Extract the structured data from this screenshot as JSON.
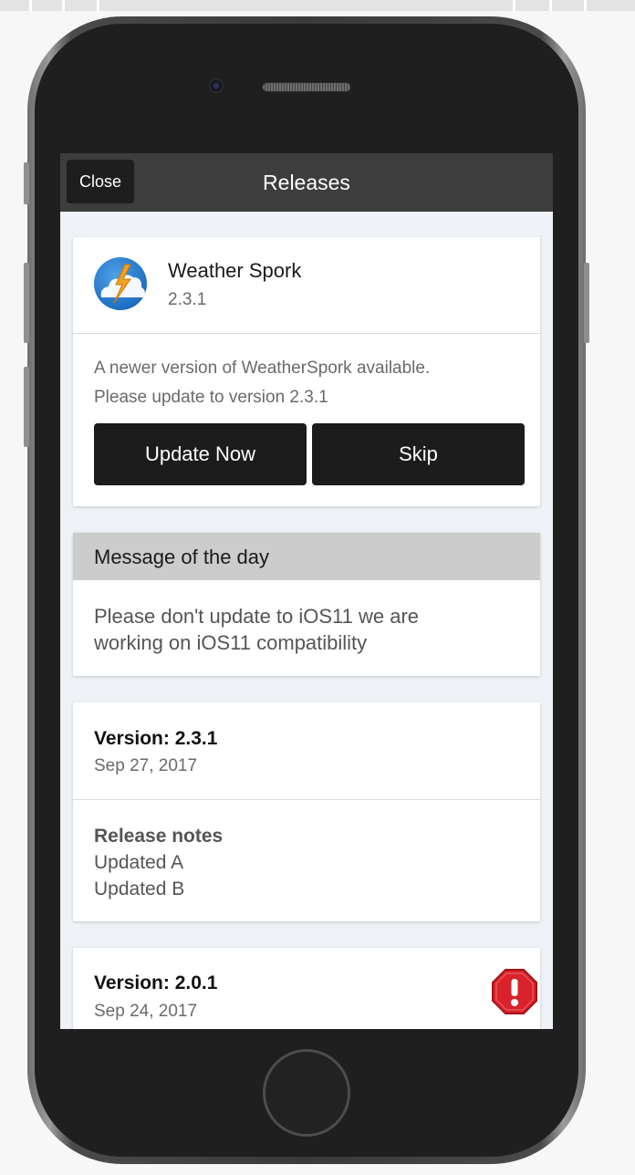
{
  "navbar": {
    "close_label": "Close",
    "title": "Releases"
  },
  "app": {
    "name": "Weather Spork",
    "version": "2.3.1",
    "update_line1": "A newer version of WeatherSpork available.",
    "update_line2": "Please update to version 2.3.1",
    "update_button": "Update Now",
    "skip_button": "Skip"
  },
  "motd": {
    "title": "Message of the day",
    "line1": "Please don't update to iOS11 we are",
    "line2": "working on iOS11 compatibility"
  },
  "releases": [
    {
      "version": "Version: 2.3.1",
      "date": "Sep 27, 2017",
      "notes_title": "Release notes",
      "notes": [
        "Updated A",
        "Updated B"
      ]
    },
    {
      "version": "Version: 2.0.1",
      "date": "Sep 24, 2017",
      "warning_icon": "warning-octagon-icon"
    }
  ],
  "colors": {
    "navbar": "#3d3d3d",
    "button": "#1c1c1c",
    "warning": "#d9222a",
    "motd_header": "#cccccc"
  }
}
